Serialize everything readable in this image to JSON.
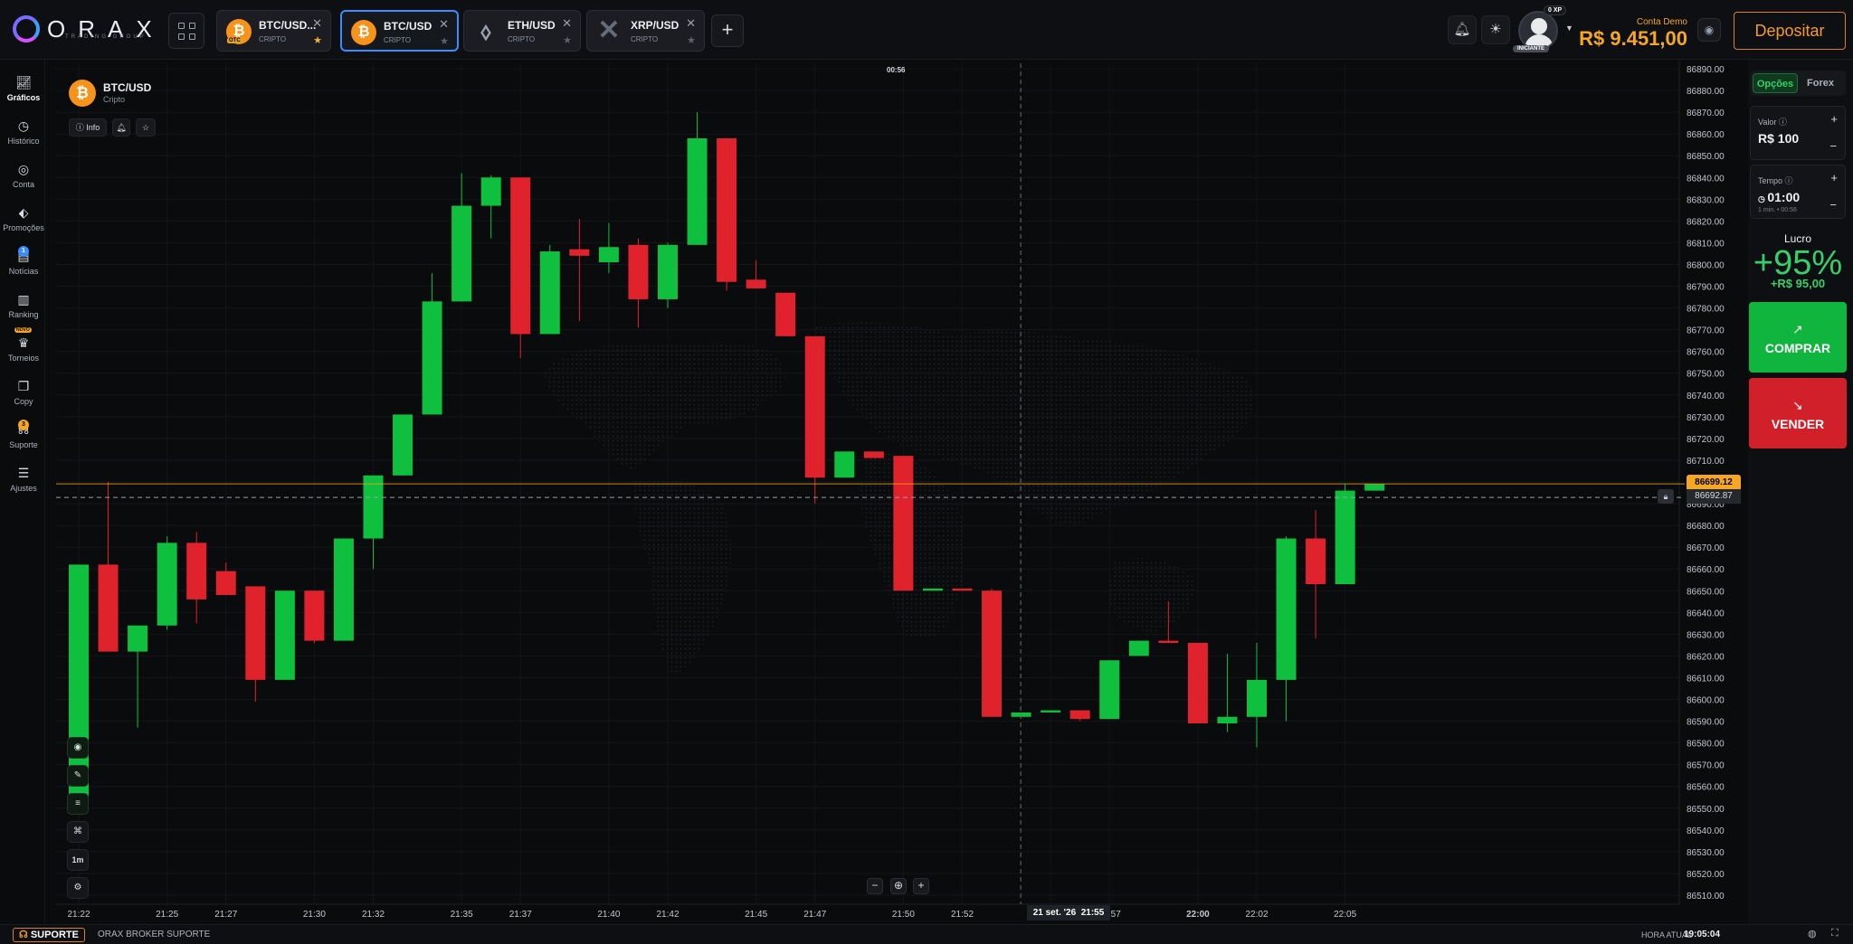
{
  "brand": {
    "name": "ORAX",
    "tagline": "TRADING GROUP"
  },
  "tabs": [
    {
      "name": "BTC/USD...",
      "category": "CRIPTO",
      "badge": "OTC",
      "starred": true,
      "active": false,
      "icon": "bitcoin-icon"
    },
    {
      "name": "BTC/USD",
      "category": "CRIPTO",
      "starred": false,
      "active": true,
      "icon": "bitcoin-icon"
    },
    {
      "name": "ETH/USD",
      "category": "CRIPTO",
      "starred": false,
      "active": false,
      "icon": "ethereum-icon"
    },
    {
      "name": "XRP/USD",
      "category": "CRIPTO",
      "starred": false,
      "active": false,
      "icon": "xrp-icon"
    }
  ],
  "user": {
    "xp": "0 XP",
    "level": "INICIANTE"
  },
  "account": {
    "label": "Conta Demo",
    "balance": "R$ 9.451,00",
    "deposit_label": "Depositar"
  },
  "sidebar": [
    {
      "label": "Gráficos",
      "icon": "chart-icon",
      "active": true
    },
    {
      "label": "Histórico",
      "icon": "clock-icon"
    },
    {
      "label": "Conta",
      "icon": "user-icon"
    },
    {
      "label": "Promoções",
      "icon": "tag-icon"
    },
    {
      "label": "Notícias",
      "icon": "news-icon",
      "badge": "1"
    },
    {
      "label": "Ranking",
      "icon": "bar-chart-icon"
    },
    {
      "label": "Torneios",
      "icon": "trophy-icon",
      "tag": "NOVO"
    },
    {
      "label": "Copy",
      "icon": "copy-icon"
    },
    {
      "label": "Suporte",
      "icon": "support-icon",
      "badge": "3"
    },
    {
      "label": "Ajustes",
      "icon": "sliders-icon"
    }
  ],
  "asset": {
    "name": "BTC/USD",
    "category": "Cripto",
    "info_label": "Info"
  },
  "candle_timer": "00:56",
  "timeframe": "1m",
  "chart_data": {
    "type": "candlestick",
    "title": "BTC/USD",
    "y_axis": {
      "ticks": [
        86890,
        86880,
        86870,
        86860,
        86850,
        86840,
        86830,
        86820,
        86810,
        86800,
        86790,
        86780,
        86770,
        86760,
        86750,
        86740,
        86730,
        86720,
        86710,
        86700,
        86690,
        86680,
        86670,
        86660,
        86650,
        86640,
        86630,
        86620,
        86610,
        86600,
        86590,
        86580,
        86570,
        86560,
        86550,
        86540,
        86530,
        86520,
        86510
      ],
      "decimals": 2,
      "range": [
        86505,
        86895
      ]
    },
    "x_axis": {
      "labels": [
        {
          "label": "21:22",
          "minute": 0
        },
        {
          "label": "21:25",
          "minute": 3
        },
        {
          "label": "21:27",
          "minute": 5
        },
        {
          "label": "21:30",
          "minute": 8
        },
        {
          "label": "21:32",
          "minute": 10
        },
        {
          "label": "21:35",
          "minute": 13
        },
        {
          "label": "21:37",
          "minute": 15
        },
        {
          "label": "21:40",
          "minute": 18
        },
        {
          "label": "21:42",
          "minute": 20
        },
        {
          "label": "21:45",
          "minute": 23
        },
        {
          "label": "21:47",
          "minute": 25
        },
        {
          "label": "21:50",
          "minute": 28
        },
        {
          "label": "21:52",
          "minute": 30
        },
        {
          "label": "21:55",
          "minute": 33
        },
        {
          "label": "21:57",
          "minute": 35
        },
        {
          "label": "22:00",
          "minute": 38
        },
        {
          "label": "22:02",
          "minute": 40
        },
        {
          "label": "22:05",
          "minute": 43
        }
      ],
      "crosshair_label": "21 set. '26",
      "crosshair_minute": 33
    },
    "current_price": "86699.12",
    "crosshair_price": "86692.87",
    "candles": [
      {
        "t": 0,
        "o": 86550,
        "h": 86662,
        "l": 86550,
        "c": 86662
      },
      {
        "t": 1,
        "o": 86662,
        "h": 86700,
        "l": 86622,
        "c": 86622
      },
      {
        "t": 2,
        "o": 86622,
        "h": 86634,
        "l": 86587,
        "c": 86634
      },
      {
        "t": 3,
        "o": 86634,
        "h": 86675,
        "l": 86632,
        "c": 86672
      },
      {
        "t": 4,
        "o": 86672,
        "h": 86677,
        "l": 86635,
        "c": 86646
      },
      {
        "t": 5,
        "o": 86659,
        "h": 86663,
        "l": 86648,
        "c": 86648
      },
      {
        "t": 6,
        "o": 86652,
        "h": 86652,
        "l": 86599,
        "c": 86609
      },
      {
        "t": 7,
        "o": 86609,
        "h": 86650,
        "l": 86609,
        "c": 86650
      },
      {
        "t": 8,
        "o": 86650,
        "h": 86650,
        "l": 86626,
        "c": 86627
      },
      {
        "t": 9,
        "o": 86627,
        "h": 86674,
        "l": 86627,
        "c": 86674
      },
      {
        "t": 10,
        "o": 86674,
        "h": 86703,
        "l": 86660,
        "c": 86703
      },
      {
        "t": 11,
        "o": 86703,
        "h": 86731,
        "l": 86703,
        "c": 86731
      },
      {
        "t": 12,
        "o": 86731,
        "h": 86796,
        "l": 86731,
        "c": 86783
      },
      {
        "t": 13,
        "o": 86783,
        "h": 86842,
        "l": 86783,
        "c": 86827
      },
      {
        "t": 14,
        "o": 86827,
        "h": 86841,
        "l": 86812,
        "c": 86840
      },
      {
        "t": 15,
        "o": 86840,
        "h": 86840,
        "l": 86757,
        "c": 86768
      },
      {
        "t": 16,
        "o": 86768,
        "h": 86809,
        "l": 86768,
        "c": 86806
      },
      {
        "t": 17,
        "o": 86807,
        "h": 86821,
        "l": 86774,
        "c": 86804
      },
      {
        "t": 18,
        "o": 86801,
        "h": 86819,
        "l": 86796,
        "c": 86808
      },
      {
        "t": 19,
        "o": 86809,
        "h": 86812,
        "l": 86771,
        "c": 86784
      },
      {
        "t": 20,
        "o": 86784,
        "h": 86810,
        "l": 86780,
        "c": 86809
      },
      {
        "t": 21,
        "o": 86809,
        "h": 86870,
        "l": 86809,
        "c": 86858
      },
      {
        "t": 22,
        "o": 86858,
        "h": 86858,
        "l": 86788,
        "c": 86792
      },
      {
        "t": 23,
        "o": 86793,
        "h": 86802,
        "l": 86789,
        "c": 86789
      },
      {
        "t": 24,
        "o": 86787,
        "h": 86787,
        "l": 86767,
        "c": 86767
      },
      {
        "t": 25,
        "o": 86767,
        "h": 86767,
        "l": 86690,
        "c": 86702
      },
      {
        "t": 26,
        "o": 86702,
        "h": 86714,
        "l": 86702,
        "c": 86714
      },
      {
        "t": 27,
        "o": 86714,
        "h": 86714,
        "l": 86711,
        "c": 86711
      },
      {
        "t": 28,
        "o": 86712,
        "h": 86712,
        "l": 86650,
        "c": 86650
      },
      {
        "t": 29,
        "o": 86650,
        "h": 86651,
        "l": 86650,
        "c": 86651
      },
      {
        "t": 30,
        "o": 86651,
        "h": 86651,
        "l": 86650,
        "c": 86650
      },
      {
        "t": 31,
        "o": 86650,
        "h": 86651,
        "l": 86592,
        "c": 86592
      },
      {
        "t": 32,
        "o": 86592,
        "h": 86594,
        "l": 86592,
        "c": 86594
      },
      {
        "t": 33,
        "o": 86594,
        "h": 86595,
        "l": 86594,
        "c": 86595
      },
      {
        "t": 34,
        "o": 86595,
        "h": 86595,
        "l": 86590,
        "c": 86591
      },
      {
        "t": 35,
        "o": 86591,
        "h": 86618,
        "l": 86591,
        "c": 86618
      },
      {
        "t": 36,
        "o": 86620,
        "h": 86627,
        "l": 86620,
        "c": 86627
      },
      {
        "t": 37,
        "o": 86627,
        "h": 86645,
        "l": 86626,
        "c": 86626
      },
      {
        "t": 38,
        "o": 86626,
        "h": 86626,
        "l": 86589,
        "c": 86589
      },
      {
        "t": 39,
        "o": 86589,
        "h": 86621,
        "l": 86585,
        "c": 86592
      },
      {
        "t": 40,
        "o": 86592,
        "h": 86626,
        "l": 86578,
        "c": 86609
      },
      {
        "t": 41,
        "o": 86609,
        "h": 86675,
        "l": 86590,
        "c": 86674
      },
      {
        "t": 42,
        "o": 86674,
        "h": 86687,
        "l": 86628,
        "c": 86653
      },
      {
        "t": 43,
        "o": 86653,
        "h": 86699,
        "l": 86653,
        "c": 86696
      },
      {
        "t": 44,
        "o": 86696,
        "h": 86699,
        "l": 86696,
        "c": 86699
      }
    ],
    "colors": {
      "up": "#0fc03f",
      "down": "#e0222c",
      "price_line": "#f5a623"
    },
    "grid": true
  },
  "right_panel": {
    "tab_options": "Opções",
    "tab_forex": "Forex",
    "amount_label": "Valor",
    "amount_value": "R$ 100",
    "time_label": "Tempo",
    "time_value": "01:00",
    "time_sub": "1 min. • 00:56",
    "profit_label": "Lucro",
    "profit_pct": "+95%",
    "profit_value": "+R$ 95,00",
    "buy_label": "COMPRAR",
    "sell_label": "VENDER"
  },
  "footer": {
    "support_label": "SUPORTE",
    "support_text": "ORAX BROKER SUPORTE",
    "time_label": "HORA ATUAL",
    "time_value": "19:05:04"
  }
}
